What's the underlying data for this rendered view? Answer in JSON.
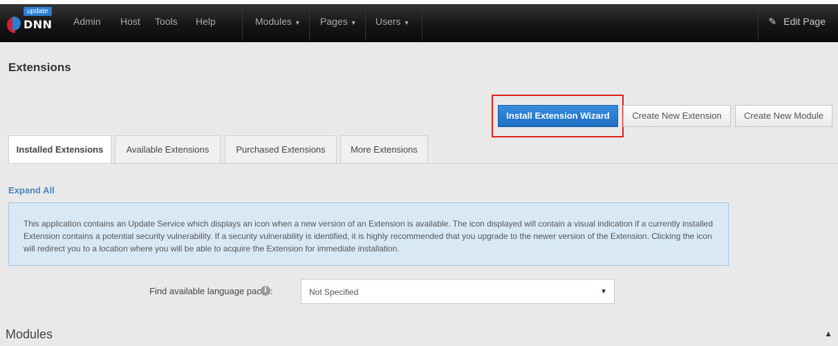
{
  "topbar": {
    "logo_text": "DNN",
    "badge": "update",
    "nav": [
      {
        "label": "Admin"
      },
      {
        "label": "Host"
      },
      {
        "label": "Tools"
      },
      {
        "label": "Help"
      }
    ],
    "menus": [
      {
        "label": "Modules"
      },
      {
        "label": "Pages"
      },
      {
        "label": "Users"
      }
    ],
    "edit_page": "Edit Page"
  },
  "page": {
    "title": "Extensions"
  },
  "actions": {
    "install": "Install Extension Wizard",
    "create_extension": "Create New Extension",
    "create_module": "Create New Module"
  },
  "tabs": [
    {
      "label": "Installed Extensions"
    },
    {
      "label": "Available Extensions"
    },
    {
      "label": "Purchased Extensions"
    },
    {
      "label": "More Extensions"
    }
  ],
  "expand_all": "Expand All",
  "info_message": "This application contains an Update Service which displays an icon when a new version of an Extension is available. The icon displayed will contain a visual indication if a currently installed Extension contains a potential security vulnerability. If a security vulnerability is identified, it is highly recommended that you upgrade to the newer version of the Extension. Clicking the icon will redirect you to a location where you will be able to acquire the Extension for immediate installation.",
  "language_packs": {
    "label": "Find available language packs:",
    "selected": "Not Specified"
  },
  "section": {
    "title": "Modules"
  },
  "colors": {
    "primary": "#1b6dc2",
    "highlight": "#e31d1d",
    "info_bg": "#d9e8f5",
    "link": "#4a86c0"
  }
}
